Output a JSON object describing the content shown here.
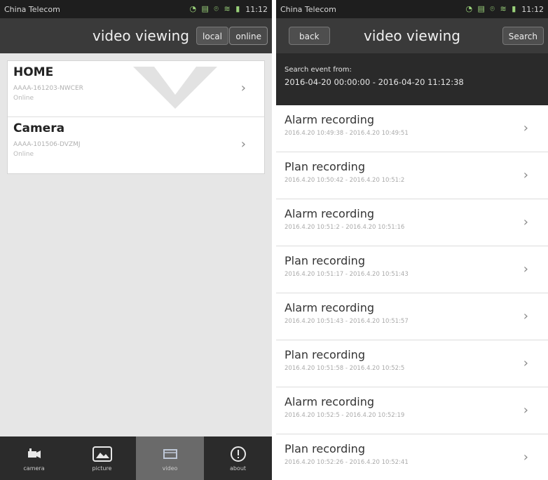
{
  "left": {
    "status": {
      "carrier": "China Telecom",
      "time": "11:12"
    },
    "title": "video viewing",
    "buttons": {
      "local": "local",
      "online": "online"
    },
    "devices": [
      {
        "name": "HOME",
        "id": "AAAA-161203-NWCER",
        "status": "Online"
      },
      {
        "name": "Camera",
        "id": "AAAA-101506-DVZMJ",
        "status": "Online"
      }
    ],
    "nav": [
      {
        "label": "camera",
        "icon": "camera-icon"
      },
      {
        "label": "picture",
        "icon": "picture-icon"
      },
      {
        "label": "video",
        "icon": "video-icon",
        "active": true
      },
      {
        "label": "about",
        "icon": "info-icon"
      }
    ]
  },
  "right": {
    "status": {
      "carrier": "China Telecom",
      "time": "11:12"
    },
    "title": "video viewing",
    "back_label": "back",
    "search_label": "Search",
    "search_from_label": "Search event from:",
    "search_range": "2016-04-20 00:00:00 - 2016-04-20 11:12:38",
    "recordings": [
      {
        "type": "Alarm recording",
        "time": "2016.4.20 10:49:38 - 2016.4.20 10:49:51"
      },
      {
        "type": "Plan recording",
        "time": "2016.4.20 10:50:42 - 2016.4.20 10:51:2"
      },
      {
        "type": "Alarm recording",
        "time": "2016.4.20 10:51:2 - 2016.4.20 10:51:16"
      },
      {
        "type": "Plan recording",
        "time": "2016.4.20 10:51:17 - 2016.4.20 10:51:43"
      },
      {
        "type": "Alarm recording",
        "time": "2016.4.20 10:51:43 - 2016.4.20 10:51:57"
      },
      {
        "type": "Plan recording",
        "time": "2016.4.20 10:51:58 - 2016.4.20 10:52:5"
      },
      {
        "type": "Alarm recording",
        "time": "2016.4.20 10:52:5 - 2016.4.20 10:52:19"
      },
      {
        "type": "Plan recording",
        "time": "2016.4.20 10:52:26 - 2016.4.20 10:52:41"
      }
    ]
  },
  "colors": {
    "title_bar": "#3a3a3a",
    "status_bar": "#1e1e1e",
    "nav_bar": "#2b2b2b",
    "nav_active": "#6a6a6a"
  }
}
